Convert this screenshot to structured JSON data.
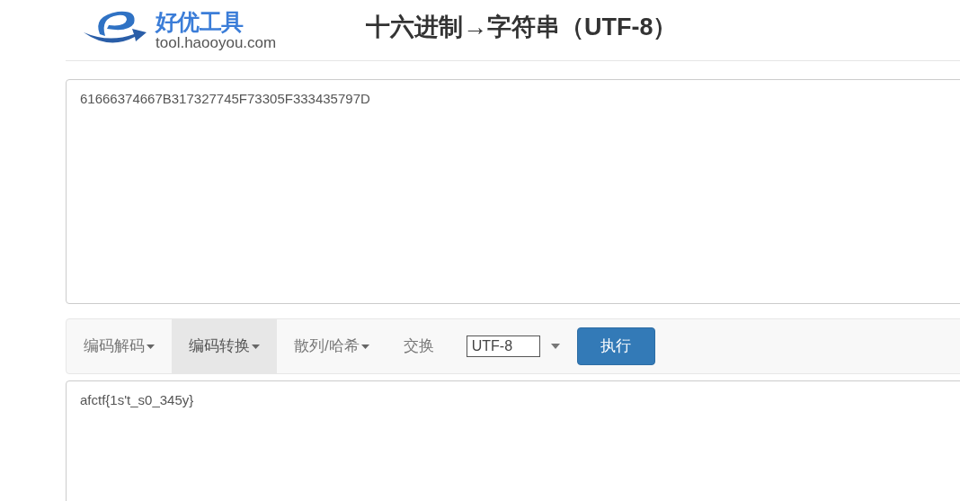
{
  "header": {
    "logo": {
      "name": "好优工具",
      "url": "tool.haooyou.com"
    },
    "title": "十六进制→字符串（UTF-8）"
  },
  "input": {
    "value": "61666374667B317327745F73305F333435797D"
  },
  "toolbar": {
    "menus": [
      {
        "label": "编码解码",
        "kind": "dropdown",
        "selected": false
      },
      {
        "label": "编码转换",
        "kind": "dropdown",
        "selected": true
      },
      {
        "label": "散列/哈希",
        "kind": "dropdown",
        "selected": false
      },
      {
        "label": "交换",
        "kind": "link",
        "selected": false
      }
    ],
    "encoding": {
      "value": "UTF-8"
    },
    "run_button": "执行"
  },
  "output": {
    "value": "afctf{1s't_s0_345y}"
  }
}
